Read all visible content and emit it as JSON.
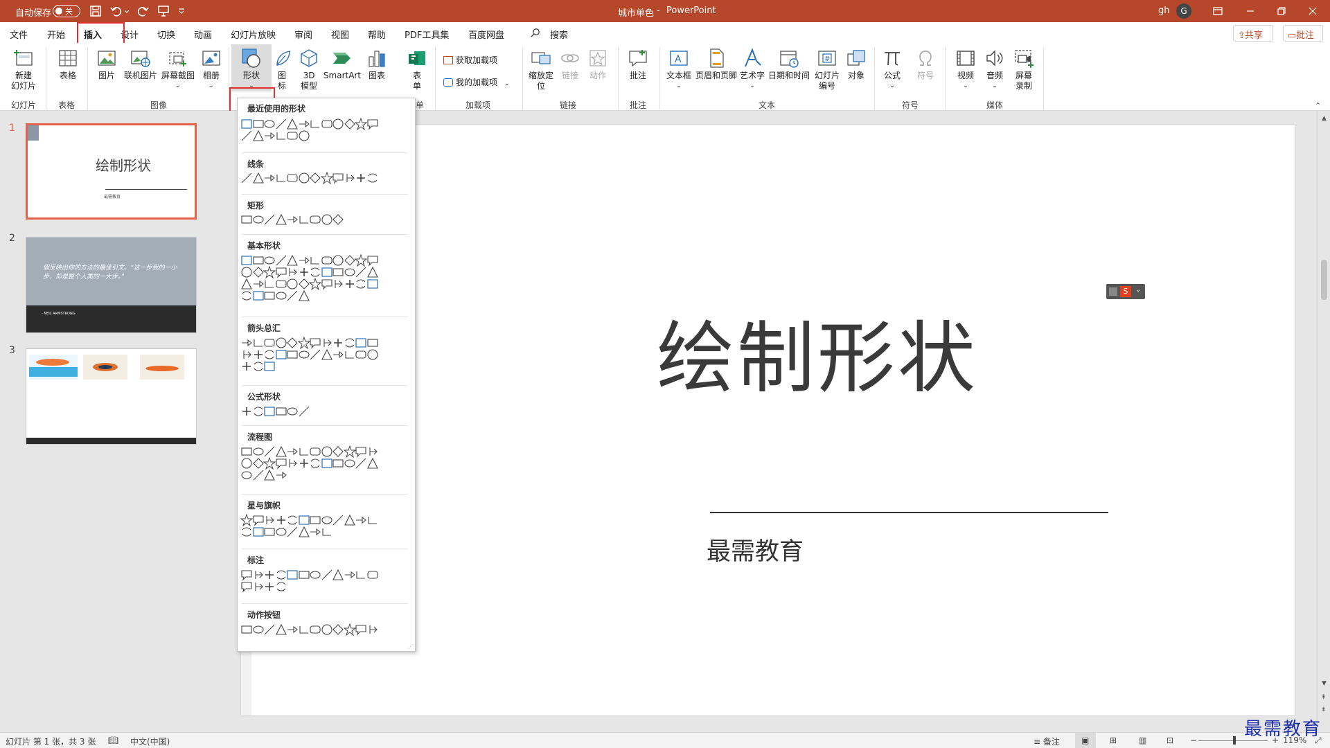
{
  "titlebar": {
    "autosave_label": "自动保存",
    "autosave_state": "关",
    "doc_title": "城市单色",
    "separator": "-",
    "app_name": "PowerPoint",
    "user_initials": "gh",
    "avatar_letter": "G",
    "accent_color": "#b7472a"
  },
  "menu": {
    "tabs": [
      "文件",
      "开始",
      "插入",
      "设计",
      "切换",
      "动画",
      "幻灯片放映",
      "审阅",
      "视图",
      "帮助",
      "PDF工具集",
      "百度网盘"
    ],
    "active_tab": "插入",
    "search_label": "搜索",
    "share_label": "共享",
    "comments_label": "批注"
  },
  "ribbon": {
    "new_slide": "新建\n幻灯片",
    "table": "表格",
    "pictures": "图片",
    "online_pictures": "联机图片",
    "screenshot": "屏幕截图",
    "album": "相册",
    "shapes": "形状",
    "icons": "图\n标",
    "model3d": "3D\n模型",
    "smartart": "SmartArt",
    "chart": "图表",
    "forms": "表\n单",
    "get_addins": "获取加载项",
    "my_addins": "我的加载项",
    "zoom": "缩放定\n位",
    "link": "链接",
    "action": "动作",
    "comment": "批注",
    "textbox": "文本框",
    "header_footer": "页眉和页脚",
    "wordart": "艺术字",
    "datetime": "日期和时间",
    "slide_number": "幻灯片\n编号",
    "object": "对象",
    "equation": "公式",
    "symbol": "符号",
    "video": "视频",
    "audio": "音频",
    "screen_recording": "屏幕\n录制",
    "groups": {
      "slides": "幻灯片",
      "tables": "表格",
      "images": "图像",
      "addins": "加载项",
      "links": "链接",
      "comments": "批注",
      "text": "文本",
      "symbols": "符号",
      "media": "媒体",
      "forms_partial": "单"
    }
  },
  "shapes_gallery": {
    "sections": [
      "最近使用的形状",
      "线条",
      "矩形",
      "基本形状",
      "箭头总汇",
      "公式形状",
      "流程图",
      "星与旗帜",
      "标注",
      "动作按钮"
    ]
  },
  "thumbnails": {
    "numbers": [
      "1",
      "2",
      "3"
    ],
    "slide1_title": "绘制形状",
    "slide1_subtitle": "最需教育",
    "slide2_quote": "假反映出你的方法的最佳引文。“这一步我的一小步，却是整个人类的一大步。”",
    "slide2_author": "- NEIL ARMSTRONG"
  },
  "slide": {
    "title": "绘制形状",
    "subtitle": "最需教育"
  },
  "statusbar": {
    "slide_info": "幻灯片 第 1 张，共 3 张",
    "language": "中文(中国)",
    "notes": "备注",
    "zoom": "119%"
  },
  "watermark": "最需教育"
}
